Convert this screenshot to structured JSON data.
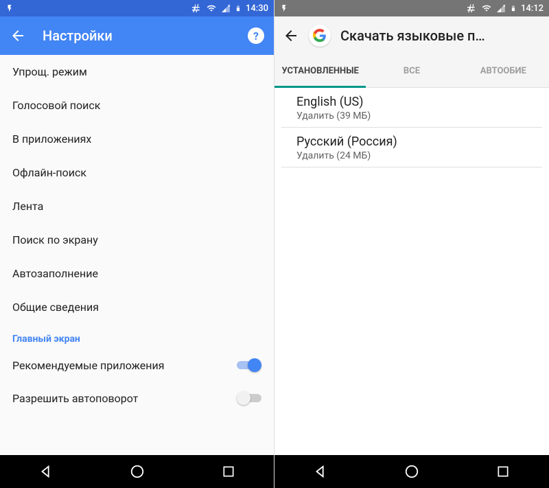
{
  "left": {
    "status_time": "14:30",
    "appbar_title": "Настройки",
    "items": [
      "Упрощ. режим",
      "Голосовой поиск",
      "В приложениях",
      "Офлайн-поиск",
      "Лента",
      "Поиск по экрану",
      "Автозаполнение",
      "Общие сведения"
    ],
    "section_header": "Главный экран",
    "toggles": [
      {
        "label": "Рекомендуемые приложения",
        "on": true
      },
      {
        "label": "Разрешить автоповорот",
        "on": false
      }
    ]
  },
  "right": {
    "status_time": "14:12",
    "appbar_title": "Скачать языковые п…",
    "tabs": [
      {
        "label": "УСТАНОВЛЕННЫЕ",
        "active": true
      },
      {
        "label": "ВСЕ",
        "active": false
      },
      {
        "label": "АВТООБИЕ",
        "active": false
      }
    ],
    "languages": [
      {
        "name": "English (US)",
        "action": "Удалить (39 МБ)"
      },
      {
        "name": "Русский (Россия)",
        "action": "Удалить (24 МБ)"
      }
    ]
  }
}
